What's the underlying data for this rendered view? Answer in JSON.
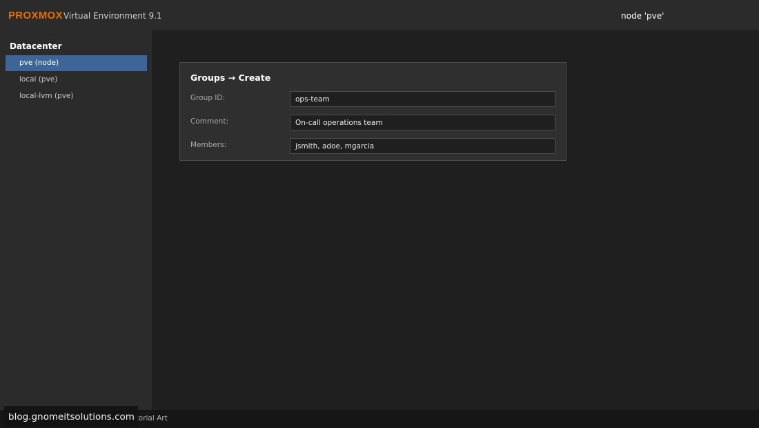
{
  "header": {
    "brand": "PROXMOX",
    "version": "Virtual Environment 9.1",
    "node_label": "node 'pve'"
  },
  "sidebar": {
    "root": "Datacenter",
    "items": [
      {
        "label": "pve (node)",
        "selected": true
      },
      {
        "label": "local (pve)",
        "selected": false
      },
      {
        "label": "local-lvm (pve)",
        "selected": false
      }
    ]
  },
  "dialog": {
    "title": "Groups → Create",
    "fields": [
      {
        "label": "Group ID:",
        "value": "ops-team"
      },
      {
        "label": "Comment:",
        "value": "On-call operations team"
      },
      {
        "label": "Members:",
        "value": "jsmith, adoe, mgarcia"
      }
    ]
  },
  "footer": {
    "text": "utorial Art",
    "watermark": "blog.gnomeitsolutions.com"
  },
  "colors": {
    "brand": "#e57000",
    "selection": "#3d6597",
    "panel": "#2f2f2f"
  }
}
